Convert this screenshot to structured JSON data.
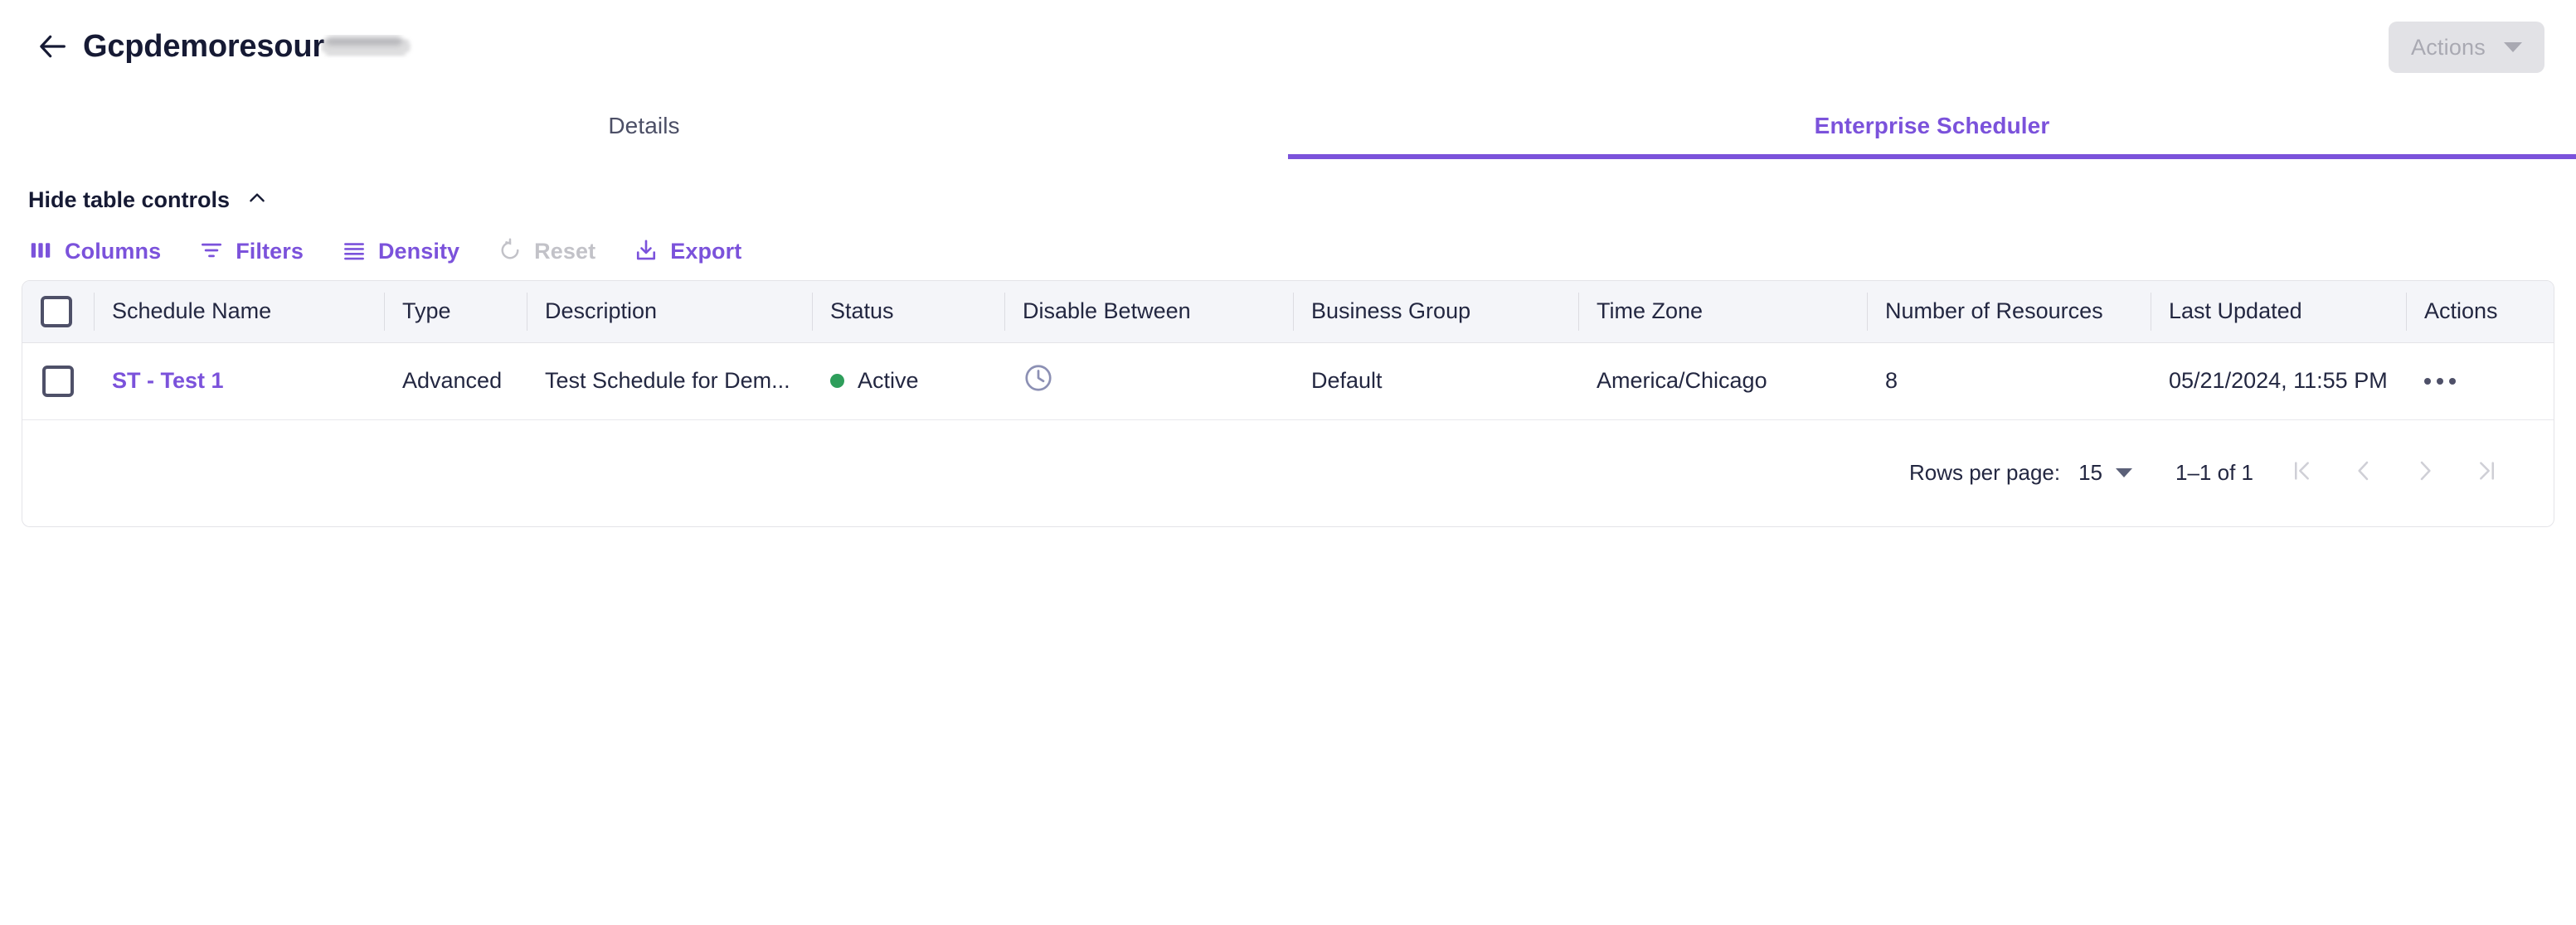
{
  "header": {
    "back_icon": "arrow-left-icon",
    "title": "Gcpdemoresour",
    "title_redacted_suffix": true,
    "actions_button": {
      "label": "Actions",
      "disabled": true,
      "icon": "chevron-down-icon"
    }
  },
  "tabs": [
    {
      "label": "Details",
      "active": false
    },
    {
      "label": "Enterprise Scheduler",
      "active": true
    }
  ],
  "table_controls": {
    "toggle_label": "Hide table controls",
    "toggle_icon": "chevron-up-icon",
    "buttons": [
      {
        "label": "Columns",
        "icon": "columns-icon",
        "disabled": false
      },
      {
        "label": "Filters",
        "icon": "filter-icon",
        "disabled": false
      },
      {
        "label": "Density",
        "icon": "density-icon",
        "disabled": false
      },
      {
        "label": "Reset",
        "icon": "reset-icon",
        "disabled": true
      },
      {
        "label": "Export",
        "icon": "download-icon",
        "disabled": false
      }
    ]
  },
  "table": {
    "columns": [
      "Schedule Name",
      "Type",
      "Description",
      "Status",
      "Disable Between",
      "Business Group",
      "Time Zone",
      "Number of Resources",
      "Last Updated",
      "Actions"
    ],
    "rows": [
      {
        "schedule_name": "ST - Test 1",
        "type": "Advanced",
        "description": "Test Schedule for Dem...",
        "status": "Active",
        "status_color": "#2e9e5b",
        "disable_between_icon": "clock-icon",
        "business_group": "Default",
        "time_zone": "America/Chicago",
        "number_of_resources": "8",
        "last_updated": "05/21/2024, 11:55 PM",
        "actions_icon": "more-horizontal-icon"
      }
    ]
  },
  "pagination": {
    "rows_per_page_label": "Rows per page:",
    "rows_per_page_value": "15",
    "range_label": "1–1 of 1",
    "first_page_icon": "first-page-icon",
    "prev_page_icon": "chevron-left-icon",
    "next_page_icon": "chevron-right-icon",
    "last_page_icon": "last-page-icon"
  },
  "colors": {
    "accent": "#7b52db",
    "text_dark": "#161a34",
    "header_bg": "#f4f5f9",
    "disabled": "#c2c2c8",
    "status_green": "#2e9e5b"
  }
}
